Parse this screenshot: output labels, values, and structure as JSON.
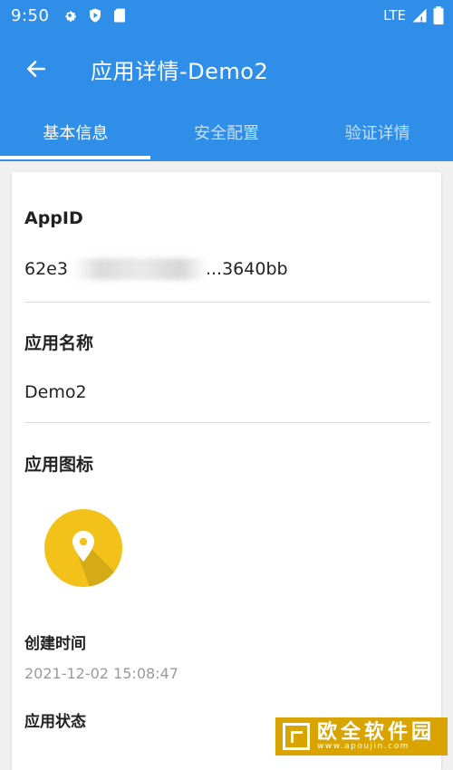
{
  "status_bar": {
    "time": "9:50",
    "network": "LTE",
    "icons": [
      "settings-icon",
      "shield-play-icon",
      "sd-card-icon",
      "signal-icon",
      "battery-icon"
    ]
  },
  "toolbar": {
    "back_icon": "arrow-left-icon",
    "title": "应用详情-Demo2"
  },
  "tabs": [
    {
      "label": "基本信息",
      "active": true
    },
    {
      "label": "安全配置",
      "active": false
    },
    {
      "label": "验证详情",
      "active": false
    }
  ],
  "details": {
    "appid_label": "AppID",
    "appid_value_prefix": "62e3",
    "appid_value_suffix": "...3640bb",
    "appname_label": "应用名称",
    "appname_value": "Demo2",
    "appicon_label": "应用图标",
    "created_label": "创建时间",
    "created_value": "2021-12-02 15:08:47",
    "status_label": "应用状态"
  },
  "watermark": {
    "brand": "欧全软件园",
    "url": "www.apoujin.com"
  },
  "colors": {
    "primary": "#2f8ee8",
    "icon_yellow": "#f2c21b"
  }
}
